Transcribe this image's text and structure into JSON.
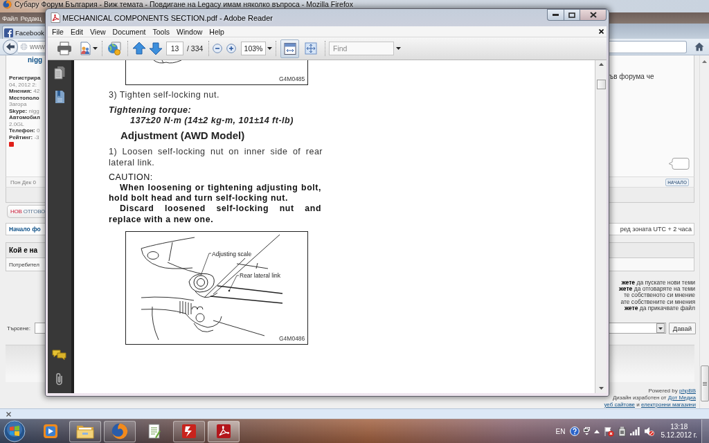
{
  "browser": {
    "title": "Субару Форум България - Виж темата - Повдигане на Legacy имам няколко въпроса - Mozilla Firefox",
    "menu": [
      "Файл",
      "Редакц"
    ],
    "tabs": [
      {
        "label": "Facebook",
        "selected": false
      }
    ],
    "address": "www",
    "page": {
      "profile": {
        "username": "nigg",
        "fields": [
          {
            "label": "Регистрира"
          },
          {
            "value": "04, 2012 2:"
          },
          {
            "label": "Мнения:",
            "value": "42"
          },
          {
            "label": "Местополо"
          },
          {
            "value": "Загора"
          },
          {
            "label": "Skype:",
            "value": "nigg"
          },
          {
            "label": "Автомобил"
          },
          {
            "value": "2.0GL"
          },
          {
            "label": "Телефон:",
            "value": "0"
          },
          {
            "label": "Рейтинг:",
            "value": "-3"
          }
        ]
      },
      "post_text": "ъв форума че",
      "post_date": "Пон Дек 0",
      "top_button": "НАЧАЛО",
      "reply_button": {
        "accent": "НОВ",
        "label": "ОТГОВО"
      },
      "breadcrumb": "Начало фо",
      "timezone": "ред зоната UTC + 2 часа",
      "online": {
        "title": "Кой е на",
        "text": "Потребител"
      },
      "permissions": [
        "**жете** да пускате нови теми",
        "**жете** да отговаряте на теми",
        "те собственото си мнение",
        "ате собствените си мнения",
        "**жете** да прикачвате файл"
      ],
      "search": {
        "label": "Търсене:",
        "button": "Давай"
      },
      "footer": [
        {
          "parts": [
            {
              "text": "Powered by",
              "link": false
            },
            {
              "text": "phpBB",
              "link": true
            }
          ]
        },
        {
          "parts": [
            {
              "text": "Дизайн изработен от",
              "link": false
            },
            {
              "text": "Дот Медиа",
              "link": true
            }
          ]
        },
        {
          "parts": [
            {
              "text": "уеб сайтове",
              "link": true
            },
            {
              "text": "и",
              "link": false
            },
            {
              "text": "електронни магазини",
              "link": true
            }
          ]
        }
      ]
    }
  },
  "reader": {
    "title": "MECHANICAL COMPONENTS SECTION.pdf - Adobe Reader",
    "menu": [
      "File",
      "Edit",
      "View",
      "Document",
      "Tools",
      "Window",
      "Help"
    ],
    "toolbar": {
      "page": "13",
      "page_count": "/ 334",
      "zoom": "103%",
      "find_placeholder": "Find",
      "view_modes": [
        {
          "selected": true
        },
        {
          "selected": false
        }
      ]
    },
    "document": [
      {
        "kind": "figure",
        "code": "G4M0485"
      },
      {
        "kind": "step",
        "text": "3) Tighten self-locking nut."
      },
      {
        "kind": "spec_label",
        "text": "Tightening torque:"
      },
      {
        "kind": "spec_value",
        "text": "137±20 N·m (14±2 kg-m, 101±14 ft-lb)"
      },
      {
        "kind": "heading",
        "text": "Adjustment (AWD Model)"
      },
      {
        "kind": "step",
        "text": "1) Loosen self-locking nut on inner side of rear lateral link."
      },
      {
        "kind": "caution_title",
        "text": "CAUTION:"
      },
      {
        "kind": "caution",
        "text": "When loosening or tightening adjusting bolt, hold bolt head and turn self-locking nut."
      },
      {
        "kind": "caution",
        "text": "Discard loosened self-locking nut and replace with a new one."
      },
      {
        "kind": "figure",
        "code": "G4M0486",
        "labels": [
          "Adjusting scale",
          "Rear lateral link"
        ]
      }
    ]
  },
  "taskbar": {
    "apps": [
      {
        "running": false,
        "selected": false
      },
      {
        "running": true,
        "selected": false
      },
      {
        "running": true,
        "selected": false
      },
      {
        "running": false,
        "selected": false
      },
      {
        "running": true,
        "selected": false
      },
      {
        "running": true,
        "selected": true
      }
    ],
    "language": "EN",
    "time": "13:18",
    "date": "5.12.2012 г."
  }
}
